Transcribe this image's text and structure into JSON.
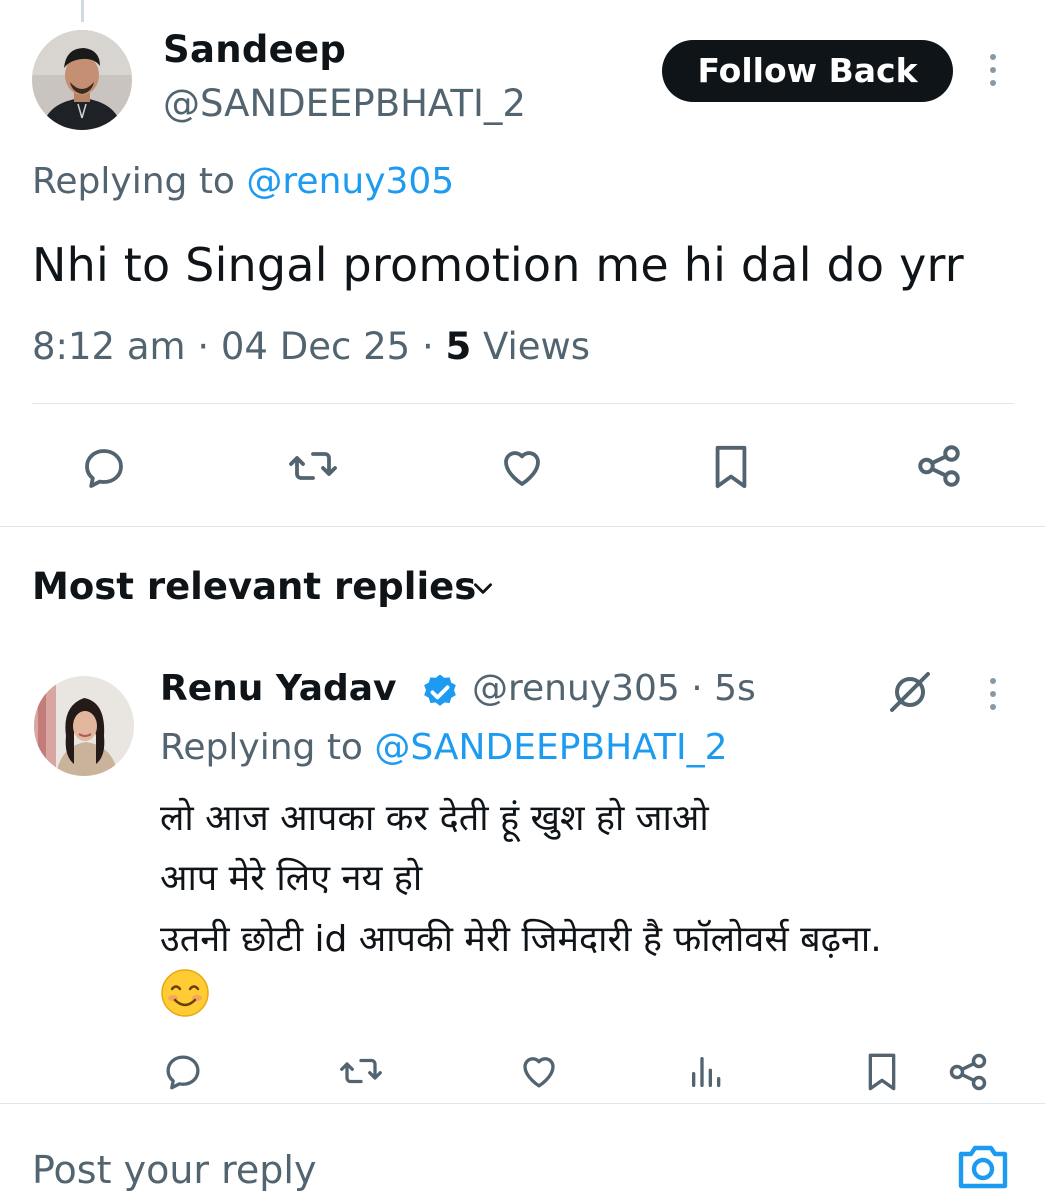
{
  "tweet": {
    "author_name": "Sandeep",
    "author_handle": "@SANDEEPBHATI_2",
    "follow_label": "Follow Back",
    "replying_prefix": "Replying to ",
    "replying_mention": "@renuy305",
    "text": "Nhi to Singal promotion me hi dal do yrr",
    "time": "8:12 am",
    "date": "04 Dec 25",
    "views_count": "5",
    "views_label": "Views"
  },
  "replies_section": {
    "title": "Most relevant replies"
  },
  "reply": {
    "author_name": "Renu Yadav",
    "author_handle": "@renuy305",
    "age": "5s",
    "replying_prefix": "Replying to ",
    "replying_mention": "@SANDEEPBHATI_2",
    "line1": "लो आज आपका कर देती हूं खुश हो जाओ",
    "line2": "आप मेरे लिए नय हो",
    "line3": "उतनी छोटी id आपकी मेरी जिमेदारी है फॉलोवर्स बढ़ना.",
    "emoji": "smiling-face-with-smiling-eyes"
  },
  "composer": {
    "placeholder": "Post your reply"
  },
  "colors": {
    "accent": "#1d9bf0",
    "text": "#0f1419",
    "secondary": "#536471",
    "icon": "#536471"
  }
}
